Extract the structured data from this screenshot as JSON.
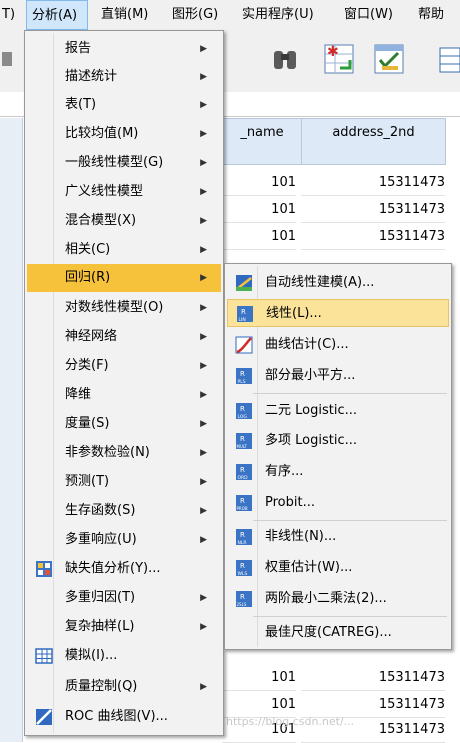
{
  "menubar": {
    "items": [
      {
        "label": "T)"
      },
      {
        "label": "分析(A)"
      },
      {
        "label": "直销(M)"
      },
      {
        "label": "图形(G)"
      },
      {
        "label": "实用程序(U)"
      },
      {
        "label": "窗口(W)"
      },
      {
        "label": "帮助"
      }
    ]
  },
  "sheet": {
    "columns": [
      "_name",
      "address_2nd"
    ],
    "rows": [
      [
        "101",
        "15311473"
      ],
      [
        "101",
        "15311473"
      ],
      [
        "101",
        "15311473"
      ],
      [
        "101",
        "15311473"
      ],
      [
        "101",
        "15311473"
      ],
      [
        "101",
        "15311473"
      ]
    ]
  },
  "analyze_menu": {
    "items": [
      {
        "label": "报告",
        "submenu": true
      },
      {
        "label": "描述统计",
        "submenu": true
      },
      {
        "label": "表(T)",
        "submenu": true
      },
      {
        "label": "比较均值(M)",
        "submenu": true
      },
      {
        "label": "一般线性模型(G)",
        "submenu": true
      },
      {
        "label": "广义线性模型",
        "submenu": true
      },
      {
        "label": "混合模型(X)",
        "submenu": true
      },
      {
        "label": "相关(C)",
        "submenu": true
      },
      {
        "label": "回归(R)",
        "submenu": true,
        "highlighted": true
      },
      {
        "label": "对数线性模型(O)",
        "submenu": true
      },
      {
        "label": "神经网络",
        "submenu": true
      },
      {
        "label": "分类(F)",
        "submenu": true
      },
      {
        "label": "降维",
        "submenu": true
      },
      {
        "label": "度量(S)",
        "submenu": true
      },
      {
        "label": "非参数检验(N)",
        "submenu": true
      },
      {
        "label": "预测(T)",
        "submenu": true
      },
      {
        "label": "生存函数(S)",
        "submenu": true
      },
      {
        "label": "多重响应(U)",
        "submenu": true
      },
      {
        "label": "缺失值分析(Y)...",
        "icon": "missing-values-icon"
      },
      {
        "label": "多重归因(T)",
        "submenu": true
      },
      {
        "label": "复杂抽样(L)",
        "submenu": true
      },
      {
        "label": "模拟(I)...",
        "icon": "simulation-icon"
      },
      {
        "label": "质量控制(Q)",
        "submenu": true
      },
      {
        "label": "ROC 曲线图(V)...",
        "icon": "roc-curve-icon"
      }
    ]
  },
  "regression_menu": {
    "items": [
      {
        "label": "自动线性建模(A)...",
        "icon": "auto-linear-icon"
      },
      {
        "label": "线性(L)...",
        "icon": "linear-icon",
        "badge": "LIN",
        "highlighted": true
      },
      {
        "label": "曲线估计(C)...",
        "icon": "curve-estimation-icon"
      },
      {
        "label": "部分最小平方...",
        "icon": "partial-least-squares-icon",
        "badge": "PLS"
      },
      {
        "label": "二元 Logistic...",
        "icon": "binary-logistic-icon",
        "badge": "LOG"
      },
      {
        "label": "多项 Logistic...",
        "icon": "multinomial-logistic-icon",
        "badge": "MULT"
      },
      {
        "label": "有序...",
        "icon": "ordinal-icon",
        "badge": "ORD"
      },
      {
        "label": "Probit...",
        "icon": "probit-icon",
        "badge": "PROB"
      },
      {
        "label": "非线性(N)...",
        "icon": "nonlinear-icon",
        "badge": "NLR"
      },
      {
        "label": "权重估计(W)...",
        "icon": "weight-estimation-icon",
        "badge": "WLS"
      },
      {
        "label": "两阶最小二乘法(2)...",
        "icon": "two-stage-least-squares-icon",
        "badge": "2SLS"
      },
      {
        "label": "最佳尺度(CATREG)..."
      }
    ]
  },
  "watermark": "https://blog.csdn.net/..."
}
